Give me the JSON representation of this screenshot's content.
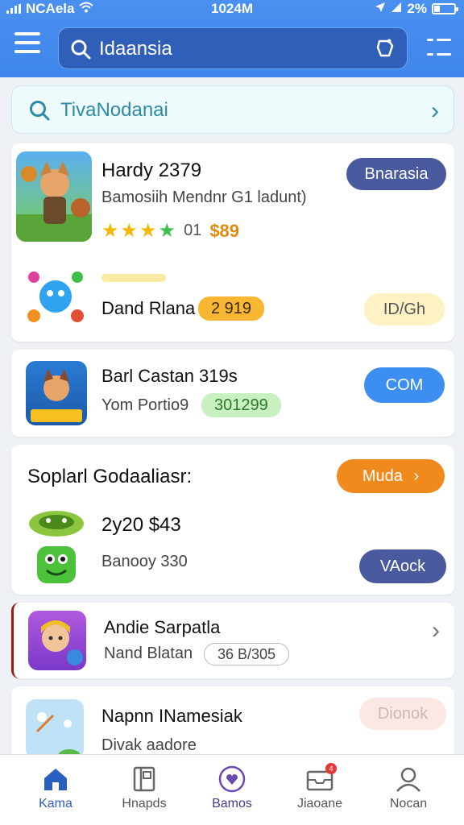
{
  "status_bar": {
    "carrier": "NCAela",
    "time": "1024M",
    "battery": "2%"
  },
  "header": {
    "search_query": "Idaansia"
  },
  "sub_search": {
    "label": "TivaNodanai"
  },
  "cards": [
    {
      "title": "Hardy 2379",
      "subtitle": "Bamosiih Mendnr G1 ladunt)",
      "rating_text": "01",
      "price": "$89",
      "action": "Bnarasia",
      "second_title": "Dand Rlana",
      "second_badge": "2 919",
      "second_action": "ID/Gh"
    },
    {
      "title": "Barl Castan 319s",
      "subtitle": "Yom Portio9",
      "badge": "301299",
      "action": "COM"
    },
    {
      "title": "Soplarl Godaaliasr:",
      "action": "Muda",
      "line1": "2y20 $43",
      "line2": "Banooy 330",
      "action2": "VAock"
    },
    {
      "title": "Andie Sarpatla",
      "subtitle": "Nand Blatan",
      "badge": "36 B/305"
    },
    {
      "title": "Napnn INamesiak",
      "subtitle": "Divak aadore",
      "action": "Dionok"
    }
  ],
  "bottom_nav": [
    {
      "label": "Kama",
      "icon": "home-icon"
    },
    {
      "label": "Hnapds",
      "icon": "book-icon"
    },
    {
      "label": "Bamos",
      "icon": "heart-circle-icon"
    },
    {
      "label": "Jiaoane",
      "icon": "inbox-icon",
      "badge": "4"
    },
    {
      "label": "Nocan",
      "icon": "profile-icon"
    }
  ],
  "colors": {
    "accent": "#3f86ec",
    "navy": "#4a5a9e",
    "orange": "#f08a1c",
    "blue_btn": "#3c8ff0"
  }
}
